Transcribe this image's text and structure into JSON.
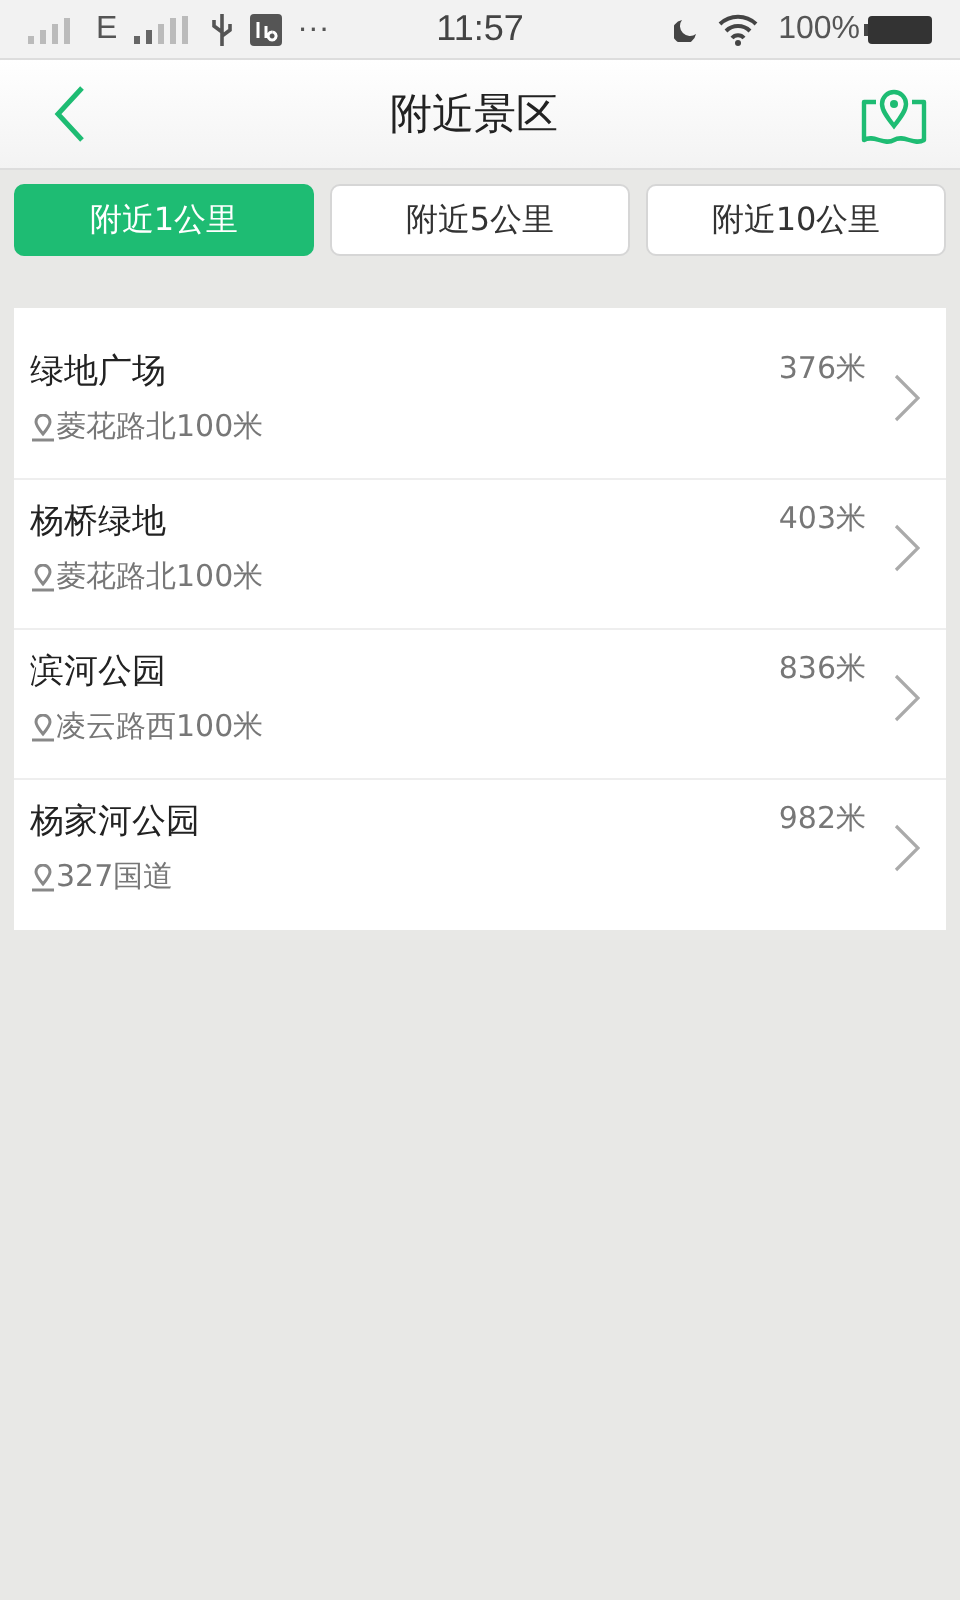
{
  "status_bar": {
    "network": "E",
    "more": "···",
    "time": "11:57",
    "battery": "100%"
  },
  "header": {
    "title": "附近景区"
  },
  "tabs": [
    {
      "label": "附近1公里",
      "selected": true
    },
    {
      "label": "附近5公里",
      "selected": false
    },
    {
      "label": "附近10公里",
      "selected": false
    }
  ],
  "places": [
    {
      "name": "绿地广场",
      "distance": "376米",
      "address": "菱花路北100米"
    },
    {
      "name": "杨桥绿地",
      "distance": "403米",
      "address": "菱花路北100米"
    },
    {
      "name": "滨河公园",
      "distance": "836米",
      "address": "凌云路西100米"
    },
    {
      "name": "杨家河公园",
      "distance": "982米",
      "address": "327国道"
    }
  ]
}
